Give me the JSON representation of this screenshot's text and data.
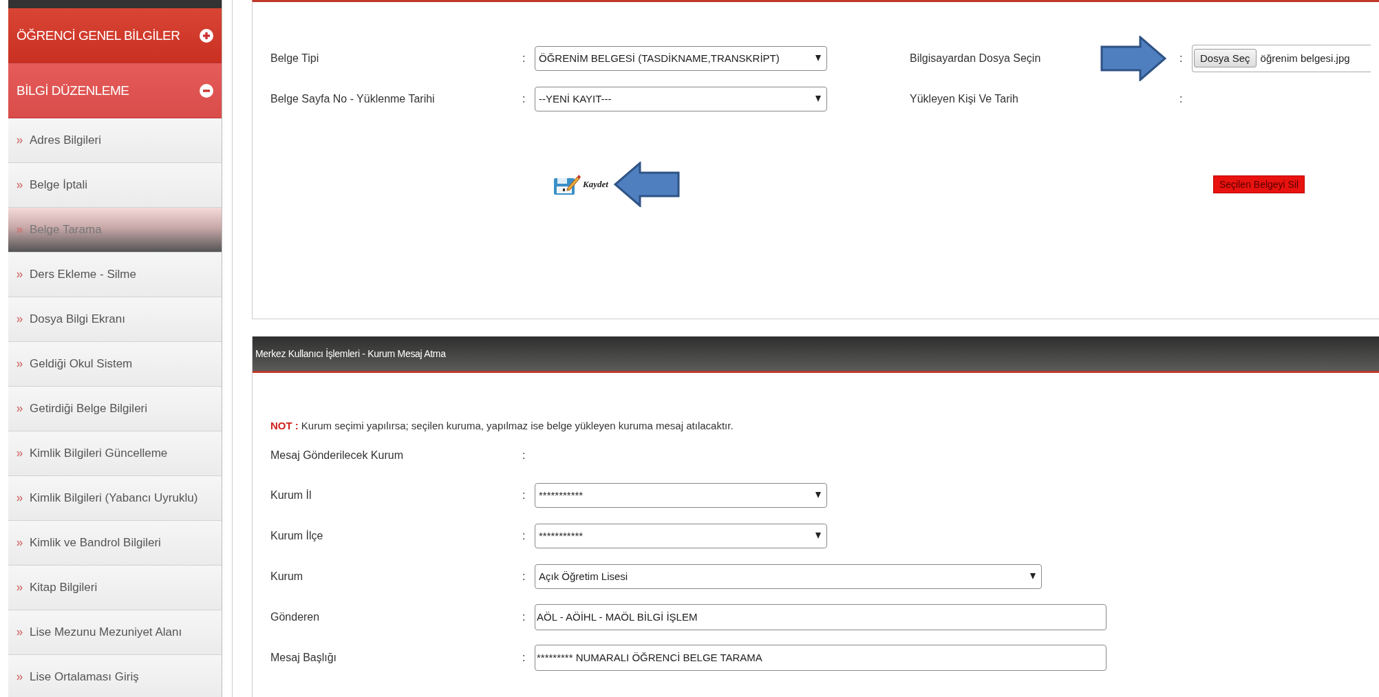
{
  "sidebar": {
    "sections": [
      {
        "title": "ÖĞRENCİ GENEL BİLGİLER",
        "expanded": false
      },
      {
        "title": "BİLGİ DÜZENLEME",
        "expanded": true,
        "items": [
          {
            "label": "Adres Bilgileri",
            "selected": false
          },
          {
            "label": "Belge İptali",
            "selected": false
          },
          {
            "label": "Belge Tarama",
            "selected": true
          },
          {
            "label": "Ders Ekleme - Silme",
            "selected": false
          },
          {
            "label": "Dosya Bilgi Ekranı",
            "selected": false
          },
          {
            "label": "Geldiği Okul Sistem",
            "selected": false
          },
          {
            "label": "Getirdiği Belge Bilgileri",
            "selected": false
          },
          {
            "label": "Kimlik Bilgileri Güncelleme",
            "selected": false
          },
          {
            "label": "Kimlik Bilgileri (Yabancı Uyruklu)",
            "selected": false
          },
          {
            "label": "Kimlik ve Bandrol Bilgileri",
            "selected": false
          },
          {
            "label": "Kitap Bilgileri",
            "selected": false
          },
          {
            "label": "Lise Mezunu Mezuniyet Alanı",
            "selected": false
          },
          {
            "label": "Lise Ortalaması Giriş",
            "selected": false
          }
        ]
      }
    ]
  },
  "upload_form": {
    "rows": [
      {
        "left": {
          "label": "Belge Tipi",
          "separator": ":",
          "kind": "select",
          "value": "ÖĞRENİM BELGESİ (TASDİKNAME,TRANSKRİPT)"
        },
        "right": {
          "label": "Bilgisayardan Dosya Seçin",
          "separator": ":",
          "kind": "file",
          "button": "Dosya Seç",
          "value": "öğrenim belgesi.jpg",
          "annotated": true
        }
      },
      {
        "left": {
          "label": "Belge Sayfa No - Yüklenme Tarihi",
          "separator": ":",
          "kind": "select",
          "value": "--YENİ KAYIT---"
        },
        "right": {
          "label": "Yükleyen Kişi Ve Tarih",
          "separator": ":",
          "kind": "empty",
          "annotated": false
        }
      }
    ],
    "save_button": {
      "label": "Kaydet",
      "annotated": true
    },
    "delete_button": "Seçilen Belgeyi Sil"
  },
  "message_panel": {
    "title": "Merkez Kullanıcı İşlemleri - Kurum Mesaj Atma",
    "note": {
      "label": "NOT :",
      "text": "Kurum seçimi yapılırsa; seçilen kuruma, yapılmaz ise belge yükleyen kuruma mesaj atılacaktır."
    },
    "fields": [
      {
        "label": "Mesaj Gönderilecek Kurum",
        "separator": ":",
        "kind": "empty"
      },
      {
        "label": "Kurum İl",
        "separator": ":",
        "kind": "select",
        "value": "***********"
      },
      {
        "label": "Kurum İlçe",
        "separator": ":",
        "kind": "select",
        "value": "***********"
      },
      {
        "label": "Kurum",
        "separator": ":",
        "kind": "wideselect",
        "value": "Açık Öğretim Lisesi"
      },
      {
        "label": "Gönderen",
        "separator": ":",
        "kind": "text",
        "value": "AÖL - AÖİHL - MAÖL BİLGİ İŞLEM"
      },
      {
        "label": "Mesaj Başlığı",
        "separator": ":",
        "kind": "text",
        "value": "********* NUMARALI ÖĞRENCİ BELGE TARAMA"
      }
    ]
  }
}
